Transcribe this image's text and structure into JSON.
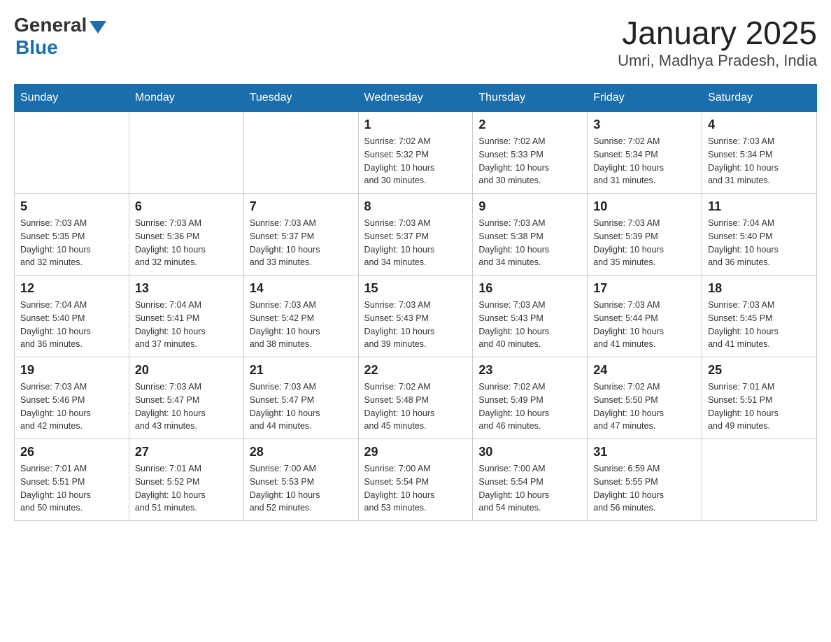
{
  "header": {
    "logo_general": "General",
    "logo_blue": "Blue",
    "month_title": "January 2025",
    "location": "Umri, Madhya Pradesh, India"
  },
  "days_of_week": [
    "Sunday",
    "Monday",
    "Tuesday",
    "Wednesday",
    "Thursday",
    "Friday",
    "Saturday"
  ],
  "weeks": [
    [
      {
        "day": "",
        "info": ""
      },
      {
        "day": "",
        "info": ""
      },
      {
        "day": "",
        "info": ""
      },
      {
        "day": "1",
        "info": "Sunrise: 7:02 AM\nSunset: 5:32 PM\nDaylight: 10 hours\nand 30 minutes."
      },
      {
        "day": "2",
        "info": "Sunrise: 7:02 AM\nSunset: 5:33 PM\nDaylight: 10 hours\nand 30 minutes."
      },
      {
        "day": "3",
        "info": "Sunrise: 7:02 AM\nSunset: 5:34 PM\nDaylight: 10 hours\nand 31 minutes."
      },
      {
        "day": "4",
        "info": "Sunrise: 7:03 AM\nSunset: 5:34 PM\nDaylight: 10 hours\nand 31 minutes."
      }
    ],
    [
      {
        "day": "5",
        "info": "Sunrise: 7:03 AM\nSunset: 5:35 PM\nDaylight: 10 hours\nand 32 minutes."
      },
      {
        "day": "6",
        "info": "Sunrise: 7:03 AM\nSunset: 5:36 PM\nDaylight: 10 hours\nand 32 minutes."
      },
      {
        "day": "7",
        "info": "Sunrise: 7:03 AM\nSunset: 5:37 PM\nDaylight: 10 hours\nand 33 minutes."
      },
      {
        "day": "8",
        "info": "Sunrise: 7:03 AM\nSunset: 5:37 PM\nDaylight: 10 hours\nand 34 minutes."
      },
      {
        "day": "9",
        "info": "Sunrise: 7:03 AM\nSunset: 5:38 PM\nDaylight: 10 hours\nand 34 minutes."
      },
      {
        "day": "10",
        "info": "Sunrise: 7:03 AM\nSunset: 5:39 PM\nDaylight: 10 hours\nand 35 minutes."
      },
      {
        "day": "11",
        "info": "Sunrise: 7:04 AM\nSunset: 5:40 PM\nDaylight: 10 hours\nand 36 minutes."
      }
    ],
    [
      {
        "day": "12",
        "info": "Sunrise: 7:04 AM\nSunset: 5:40 PM\nDaylight: 10 hours\nand 36 minutes."
      },
      {
        "day": "13",
        "info": "Sunrise: 7:04 AM\nSunset: 5:41 PM\nDaylight: 10 hours\nand 37 minutes."
      },
      {
        "day": "14",
        "info": "Sunrise: 7:03 AM\nSunset: 5:42 PM\nDaylight: 10 hours\nand 38 minutes."
      },
      {
        "day": "15",
        "info": "Sunrise: 7:03 AM\nSunset: 5:43 PM\nDaylight: 10 hours\nand 39 minutes."
      },
      {
        "day": "16",
        "info": "Sunrise: 7:03 AM\nSunset: 5:43 PM\nDaylight: 10 hours\nand 40 minutes."
      },
      {
        "day": "17",
        "info": "Sunrise: 7:03 AM\nSunset: 5:44 PM\nDaylight: 10 hours\nand 41 minutes."
      },
      {
        "day": "18",
        "info": "Sunrise: 7:03 AM\nSunset: 5:45 PM\nDaylight: 10 hours\nand 41 minutes."
      }
    ],
    [
      {
        "day": "19",
        "info": "Sunrise: 7:03 AM\nSunset: 5:46 PM\nDaylight: 10 hours\nand 42 minutes."
      },
      {
        "day": "20",
        "info": "Sunrise: 7:03 AM\nSunset: 5:47 PM\nDaylight: 10 hours\nand 43 minutes."
      },
      {
        "day": "21",
        "info": "Sunrise: 7:03 AM\nSunset: 5:47 PM\nDaylight: 10 hours\nand 44 minutes."
      },
      {
        "day": "22",
        "info": "Sunrise: 7:02 AM\nSunset: 5:48 PM\nDaylight: 10 hours\nand 45 minutes."
      },
      {
        "day": "23",
        "info": "Sunrise: 7:02 AM\nSunset: 5:49 PM\nDaylight: 10 hours\nand 46 minutes."
      },
      {
        "day": "24",
        "info": "Sunrise: 7:02 AM\nSunset: 5:50 PM\nDaylight: 10 hours\nand 47 minutes."
      },
      {
        "day": "25",
        "info": "Sunrise: 7:01 AM\nSunset: 5:51 PM\nDaylight: 10 hours\nand 49 minutes."
      }
    ],
    [
      {
        "day": "26",
        "info": "Sunrise: 7:01 AM\nSunset: 5:51 PM\nDaylight: 10 hours\nand 50 minutes."
      },
      {
        "day": "27",
        "info": "Sunrise: 7:01 AM\nSunset: 5:52 PM\nDaylight: 10 hours\nand 51 minutes."
      },
      {
        "day": "28",
        "info": "Sunrise: 7:00 AM\nSunset: 5:53 PM\nDaylight: 10 hours\nand 52 minutes."
      },
      {
        "day": "29",
        "info": "Sunrise: 7:00 AM\nSunset: 5:54 PM\nDaylight: 10 hours\nand 53 minutes."
      },
      {
        "day": "30",
        "info": "Sunrise: 7:00 AM\nSunset: 5:54 PM\nDaylight: 10 hours\nand 54 minutes."
      },
      {
        "day": "31",
        "info": "Sunrise: 6:59 AM\nSunset: 5:55 PM\nDaylight: 10 hours\nand 56 minutes."
      },
      {
        "day": "",
        "info": ""
      }
    ]
  ]
}
